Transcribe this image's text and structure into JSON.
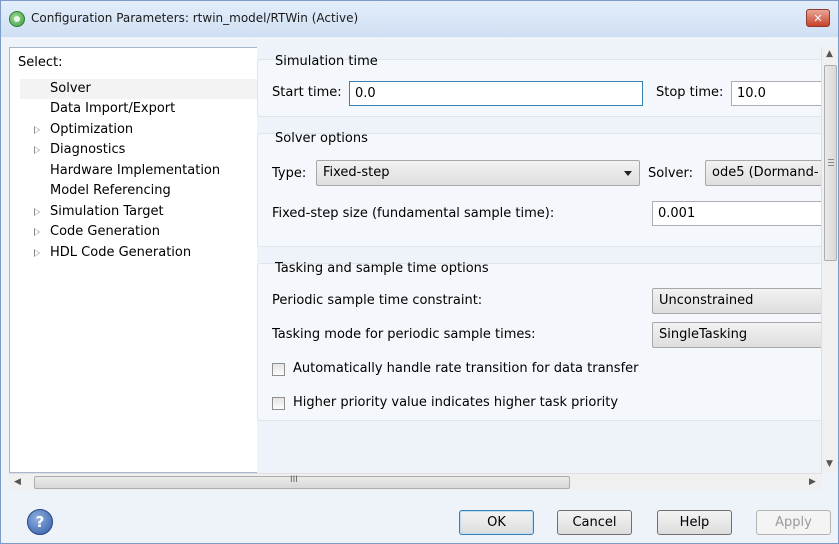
{
  "window": {
    "title": "Configuration Parameters: rtwin_model/RTWin (Active)",
    "close_glyph": "✕"
  },
  "tree": {
    "header": "Select:",
    "items": [
      {
        "label": "Solver",
        "expandable": false,
        "selected": true
      },
      {
        "label": "Data Import/Export",
        "expandable": false
      },
      {
        "label": "Optimization",
        "expandable": true
      },
      {
        "label": "Diagnostics",
        "expandable": true
      },
      {
        "label": "Hardware Implementation",
        "expandable": false
      },
      {
        "label": "Model Referencing",
        "expandable": false
      },
      {
        "label": "Simulation Target",
        "expandable": true
      },
      {
        "label": "Code Generation",
        "expandable": true
      },
      {
        "label": "HDL Code Generation",
        "expandable": true
      }
    ]
  },
  "simulation_time": {
    "title": "Simulation time",
    "start_label": "Start time:",
    "start_value": "0.0",
    "stop_label": "Stop time:",
    "stop_value": "10.0"
  },
  "solver_options": {
    "title": "Solver options",
    "type_label": "Type:",
    "type_value": "Fixed-step",
    "solver_label": "Solver:",
    "solver_value": "ode5 (Dormand-",
    "step_label": "Fixed-step size (fundamental sample time):",
    "step_value": "0.001"
  },
  "tasking": {
    "title": "Tasking and sample time options",
    "periodic_label": "Periodic sample time constraint:",
    "periodic_value": "Unconstrained",
    "mode_label": "Tasking mode for periodic sample times:",
    "mode_value": "SingleTasking",
    "auto_rate_label": "Automatically handle rate transition for data transfer",
    "auto_rate_checked": false,
    "priority_label": "Higher priority value indicates higher task priority",
    "priority_checked": false
  },
  "scrollbar": {
    "h_thumb_glyph": "III"
  },
  "buttons": {
    "help_glyph": "?",
    "ok": "OK",
    "cancel": "Cancel",
    "help": "Help",
    "apply": "Apply"
  },
  "colors": {
    "accent": "#3c7fb1",
    "window_border": "#7b9cc8"
  }
}
